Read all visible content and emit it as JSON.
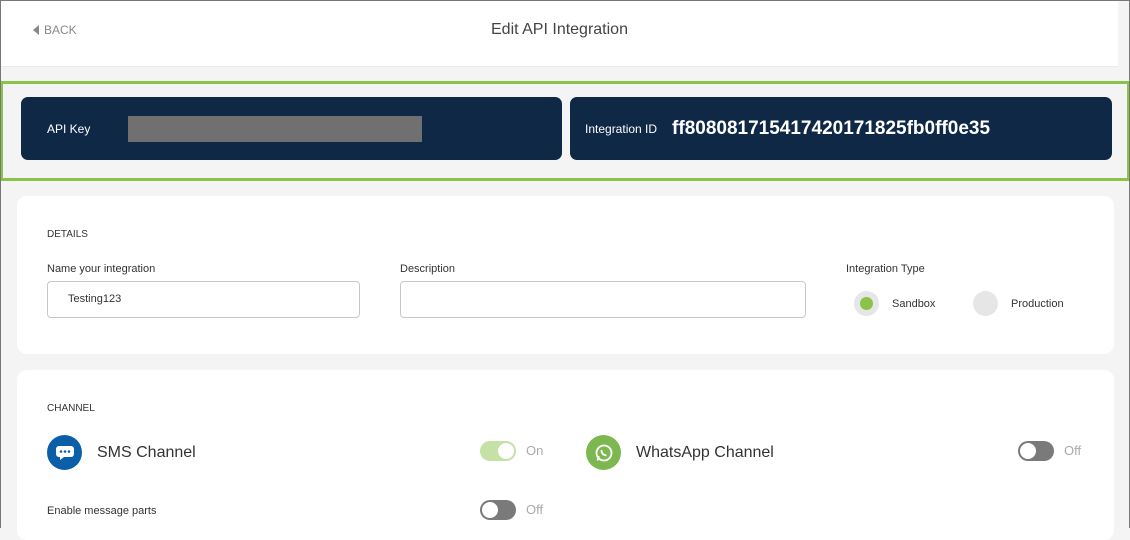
{
  "header": {
    "back_label": "BACK",
    "title": "Edit API Integration"
  },
  "keys": {
    "api_key_label": "API Key",
    "integration_id_label": "Integration ID",
    "integration_id": "ff80808171541742017182​5fb0ff0e35"
  },
  "details": {
    "section": "DETAILS",
    "name_label": "Name your integration",
    "name_value": "Testing123",
    "description_label": "Description",
    "description_value": "",
    "type_label": "Integration Type",
    "types": [
      {
        "label": "Sandbox",
        "selected": true
      },
      {
        "label": "Production",
        "selected": false
      }
    ]
  },
  "channel": {
    "section": "CHANNEL",
    "sms": {
      "label": "SMS Channel",
      "state": "On"
    },
    "whatsapp": {
      "label": "WhatsApp Channel",
      "state": "Off"
    },
    "parts": {
      "label": "Enable message parts",
      "state": "Off"
    }
  },
  "colors": {
    "navy": "#0f2846",
    "green": "#8bc34a",
    "sms_blue": "#0b5fa8",
    "whatsapp_green": "#7cb84f"
  }
}
